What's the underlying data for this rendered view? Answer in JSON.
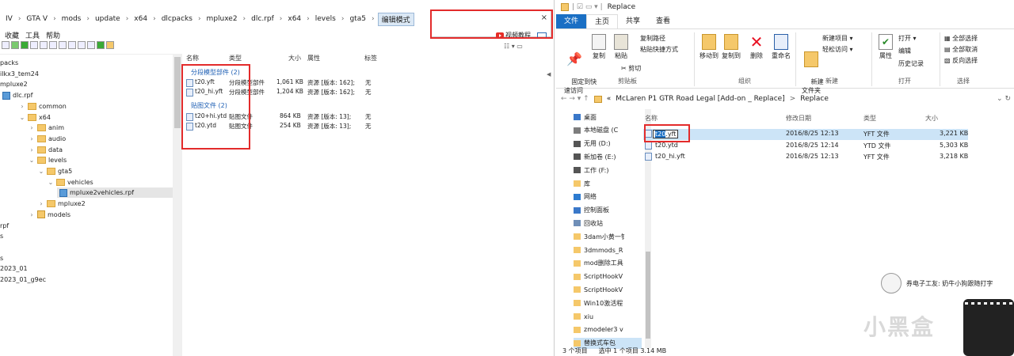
{
  "left": {
    "breadcrumb": [
      "IV",
      "GTA V",
      "mods",
      "update",
      "x64",
      "dlcpacks",
      "mpluxe2",
      "dlc.rpf",
      "x64",
      "levels",
      "gta5"
    ],
    "edit_mode": "编辑模式",
    "search_close": "×",
    "menu": [
      "收藏",
      "工具",
      "帮助"
    ],
    "tutorial": "视频教程",
    "tree": [
      {
        "label": "packs",
        "indent": 0,
        "type": "none"
      },
      {
        "label": "ilkx3_tem24",
        "indent": 0,
        "type": "none"
      },
      {
        "label": "mpluxe2",
        "indent": 0,
        "type": "none"
      },
      {
        "label": "dlc.rpf",
        "indent": 0,
        "type": "rpf"
      },
      {
        "label": "common",
        "indent": 2,
        "type": "folder",
        "arrow": ">"
      },
      {
        "label": "x64",
        "indent": 2,
        "type": "folder",
        "arrow": "v"
      },
      {
        "label": "anim",
        "indent": 3,
        "type": "folder",
        "arrow": ">"
      },
      {
        "label": "audio",
        "indent": 3,
        "type": "folder",
        "arrow": ">"
      },
      {
        "label": "data",
        "indent": 3,
        "type": "folder",
        "arrow": ">"
      },
      {
        "label": "levels",
        "indent": 3,
        "type": "folder",
        "arrow": "v"
      },
      {
        "label": "gta5",
        "indent": 4,
        "type": "folder",
        "arrow": "v"
      },
      {
        "label": "vehicles",
        "indent": 5,
        "type": "folder",
        "arrow": "v"
      },
      {
        "label": "mpluxe2vehicles.rpf",
        "indent": 6,
        "type": "rpf",
        "selected": true
      },
      {
        "label": "mpluxe2",
        "indent": 4,
        "type": "folder",
        "arrow": ">"
      },
      {
        "label": "models",
        "indent": 3,
        "type": "models",
        "arrow": ">"
      },
      {
        "label": "rpf",
        "indent": 0,
        "type": "none"
      },
      {
        "label": "s",
        "indent": 0,
        "type": "none"
      },
      {
        "label": "",
        "indent": 0,
        "type": "none"
      },
      {
        "label": "s",
        "indent": 0,
        "type": "none"
      },
      {
        "label": "2023_01",
        "indent": 0,
        "type": "none"
      },
      {
        "label": "2023_01_g9ec",
        "indent": 0,
        "type": "none"
      }
    ],
    "headers": {
      "name": "名称",
      "type": "类型",
      "size": "大小",
      "attr": "属性",
      "tag": "标签"
    },
    "groups": [
      {
        "title": "分段模型部件 (2)",
        "files": [
          {
            "name": "t20.yft",
            "type": "分段模型部件",
            "size": "1,061 KB",
            "attr": "资源 [版本: 162];",
            "tag": "无"
          },
          {
            "name": "t20_hi.yft",
            "type": "分段模型部件",
            "size": "1,204 KB",
            "attr": "资源 [版本: 162];",
            "tag": "无"
          }
        ]
      },
      {
        "title": "贴图文件 (2)",
        "files": [
          {
            "name": "t20+hi.ytd",
            "type": "贴图文件",
            "size": "864 KB",
            "attr": "资源 [版本: 13];",
            "tag": "无"
          },
          {
            "name": "t20.ytd",
            "type": "贴图文件",
            "size": "254 KB",
            "attr": "资源 [版本: 13];",
            "tag": "无"
          }
        ]
      }
    ]
  },
  "right": {
    "title": "Replace",
    "tabs": [
      "文件",
      "主页",
      "共享",
      "查看"
    ],
    "ribbon": {
      "pin": "固定到快\n速访问",
      "copy": "复制",
      "paste": "粘贴",
      "copy_path": "复制路径",
      "paste_shortcut": "粘贴快捷方式",
      "cut": "剪切",
      "group_clipboard": "剪贴板",
      "move_to": "移动到",
      "copy_to": "复制到",
      "delete": "删除",
      "rename": "重命名",
      "group_organize": "组织",
      "new_folder": "新建\n文件夹",
      "new_item": "新建项目 ▾",
      "easy_access": "轻松访问 ▾",
      "group_new": "新建",
      "properties": "属性",
      "open": "打开 ▾",
      "edit": "编辑",
      "history": "历史记录",
      "group_open": "打开",
      "select_all": "全部选择",
      "select_none": "全部取消",
      "invert": "反向选择",
      "group_select": "选择"
    },
    "address": [
      "«",
      "McLaren P1 GTR Road Legal [Add-on _ Replace]",
      ">",
      "Replace"
    ],
    "nav": [
      "桌面",
      "本地磁盘 (C",
      "无用 (D:)",
      "新加卷 (E:)",
      "工作 (F:)",
      "库",
      "网络",
      "控制面板",
      "回收站",
      "3dam小黄一钅",
      "3dmmods_R",
      "mod删除工具",
      "ScriptHookV",
      "ScriptHookV",
      "Win10激活程",
      "xiu",
      "zmodeler3 v",
      "替换式车包"
    ],
    "list_headers": {
      "name": "名称",
      "date": "修改日期",
      "type": "类型",
      "size": "大小"
    },
    "files": [
      {
        "name": "t20.yft",
        "date": "2016/8/25 12:13",
        "type": "YFT 文件",
        "size": "3,221 KB"
      },
      {
        "name": "t20.ytd",
        "date": "2016/8/25 12:14",
        "type": "YTD 文件",
        "size": "5,303 KB"
      },
      {
        "name": "t20_hi.yft",
        "date": "2016/8/25 12:13",
        "type": "YFT 文件",
        "size": "3,218 KB"
      }
    ],
    "rename_value": "t20",
    "rename_suffix": ".yft",
    "status": [
      "3 个项目",
      "选中 1 个项目  3.14 MB"
    ]
  },
  "overlay": {
    "comment": "券电子工友: 奶牛小狗跟随打字",
    "watermark": "小黑盒"
  }
}
